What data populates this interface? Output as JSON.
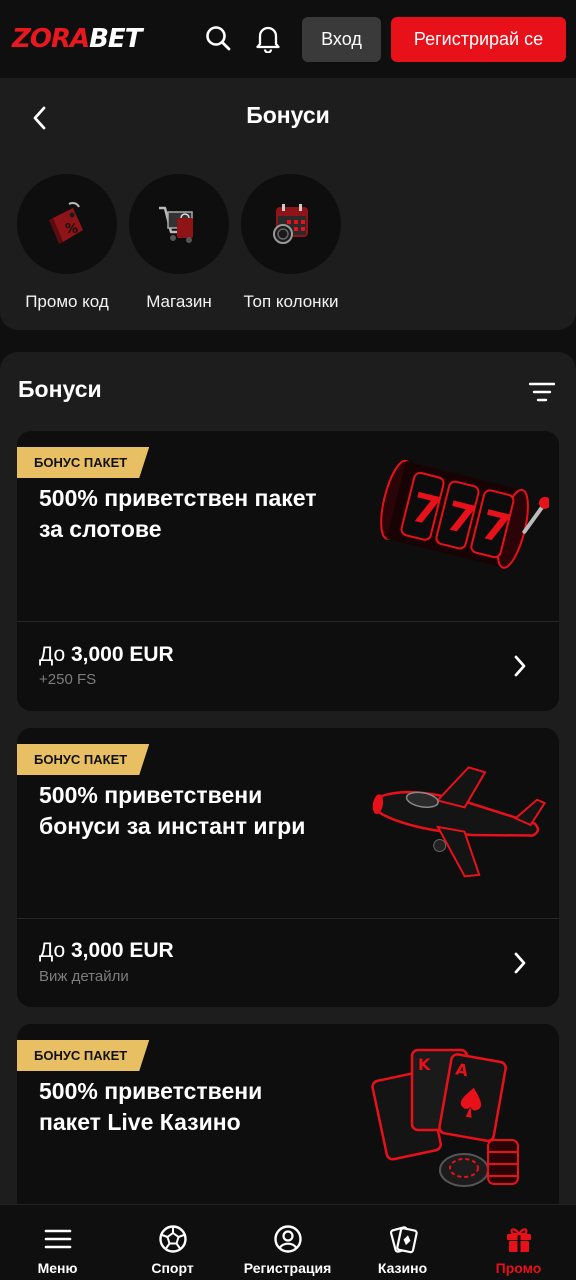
{
  "header": {
    "logo_part1": "ZORA",
    "logo_part2": "BET",
    "login_label": "Вход",
    "register_label": "Регистрирай се"
  },
  "page": {
    "title": "Бонуси"
  },
  "quick_links": [
    {
      "label": "Промо код",
      "icon": "promo-tag-icon"
    },
    {
      "label": "Магазин",
      "icon": "shopping-cart-icon"
    },
    {
      "label": "Топ колонки",
      "icon": "calendar-icon"
    }
  ],
  "bonuses": {
    "section_title": "Бонуси",
    "cards": [
      {
        "badge": "БОНУС ПАКЕТ",
        "title": "500% приветствен пакет за слотове",
        "amount_prefix": "До ",
        "amount_value": "3,000 EUR",
        "subtitle": "+250 FS",
        "art": "slot-machine-777"
      },
      {
        "badge": "БОНУС ПАКЕТ",
        "title": "500% приветствени бонуси за инстант игри",
        "amount_prefix": "До ",
        "amount_value": "3,000 EUR",
        "subtitle": "Виж детайли",
        "art": "airplane"
      },
      {
        "badge": "БОНУС ПАКЕТ",
        "title": "500% приветствени пакет Live Казино",
        "art": "playing-cards-chips"
      }
    ]
  },
  "bottom_nav": [
    {
      "label": "Меню",
      "icon": "menu-icon",
      "active": false
    },
    {
      "label": "Спорт",
      "icon": "football-icon",
      "active": false
    },
    {
      "label": "Регистрация",
      "icon": "user-icon",
      "active": false
    },
    {
      "label": "Казино",
      "icon": "cards-icon",
      "active": false
    },
    {
      "label": "Промо",
      "icon": "gift-icon",
      "active": true
    }
  ],
  "colors": {
    "accent_red": "#e8111a",
    "badge_gold": "#e8c063",
    "panel_bg": "#1d1d1d",
    "card_bg": "#0e0e0e"
  }
}
